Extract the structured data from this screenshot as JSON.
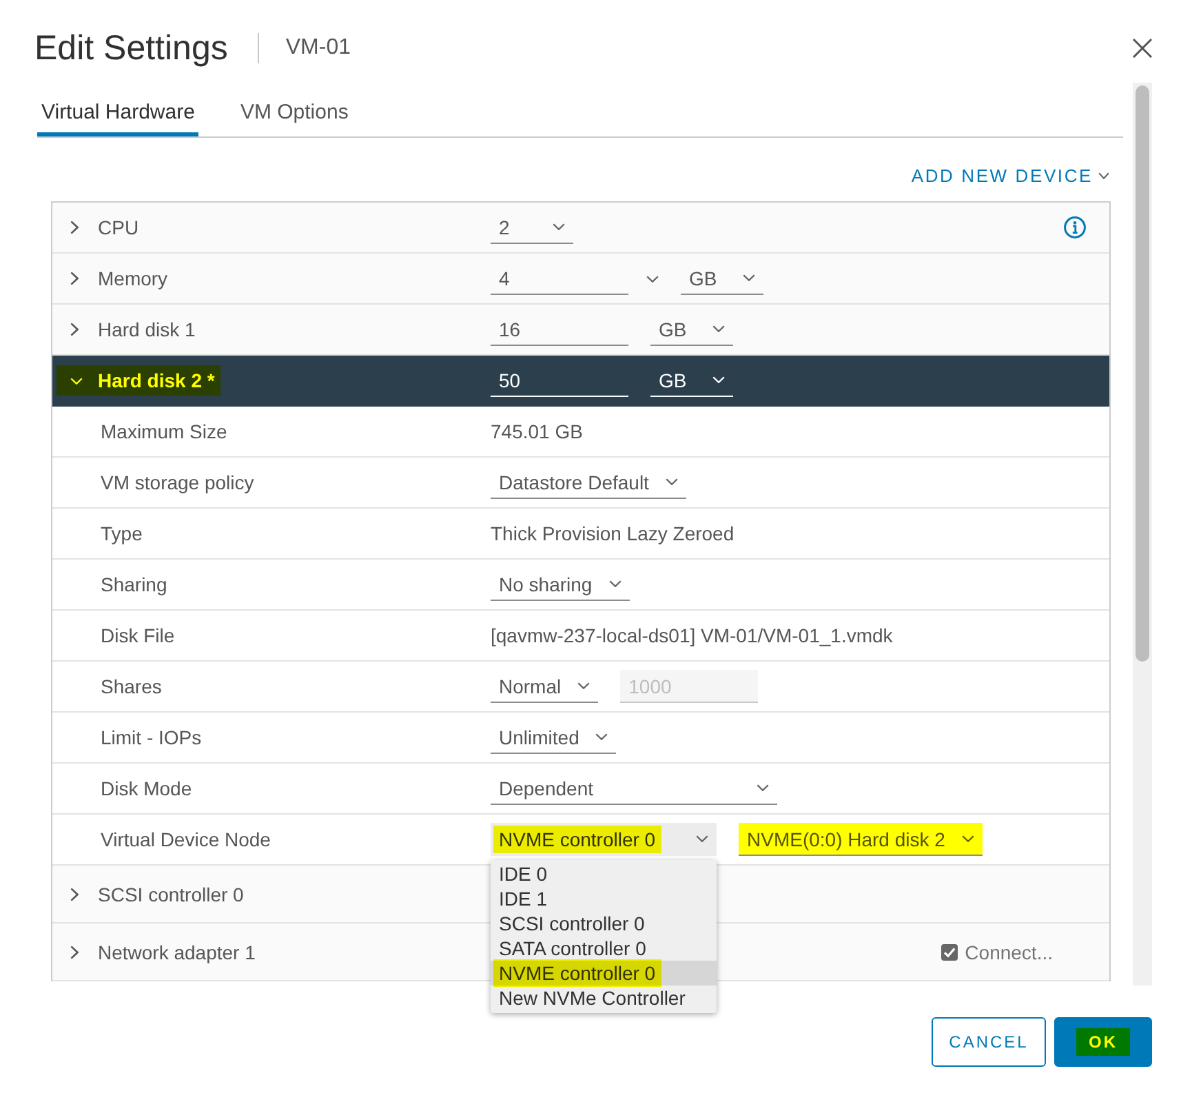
{
  "window": {
    "title": "Edit Settings",
    "subtitle": "VM-01"
  },
  "tabs": [
    {
      "label": "Virtual Hardware",
      "selected": true
    },
    {
      "label": "VM Options",
      "selected": false
    }
  ],
  "add_device": {
    "label": "ADD NEW DEVICE"
  },
  "devices": [
    {
      "label": "CPU",
      "expanded": false,
      "highlighted": false,
      "controls": [
        {
          "kind": "select",
          "value": "2"
        },
        {
          "kind": "info"
        }
      ]
    },
    {
      "label": "Memory",
      "expanded": false,
      "highlighted": false,
      "controls": [
        {
          "kind": "combo",
          "value": "4"
        },
        {
          "kind": "select",
          "value": "GB"
        }
      ]
    },
    {
      "label": "Hard disk 1",
      "expanded": false,
      "highlighted": false,
      "controls": [
        {
          "kind": "input",
          "value": "16",
          "disabled": false
        },
        {
          "kind": "select",
          "value": "GB"
        }
      ]
    },
    {
      "label": "Hard disk 2 *",
      "expanded": true,
      "highlighted": true,
      "controls": [
        {
          "kind": "input",
          "value": "50",
          "disabled": false
        },
        {
          "kind": "select",
          "value": "GB"
        }
      ],
      "children": [
        {
          "label": "Maximum Size",
          "controls": [
            {
              "kind": "text",
              "value": "745.01 GB"
            }
          ]
        },
        {
          "label": "VM storage policy",
          "controls": [
            {
              "kind": "select",
              "value": "Datastore Default"
            }
          ]
        },
        {
          "label": "Type",
          "controls": [
            {
              "kind": "text",
              "value": "Thick Provision Lazy Zeroed"
            }
          ]
        },
        {
          "label": "Sharing",
          "controls": [
            {
              "kind": "select",
              "value": "No sharing"
            }
          ]
        },
        {
          "label": "Disk File",
          "controls": [
            {
              "kind": "text",
              "value": "[qavmw-237-local-ds01] VM-01/VM-01_1.vmdk"
            }
          ]
        },
        {
          "label": "Shares",
          "controls": [
            {
              "kind": "select",
              "value": "Normal"
            },
            {
              "kind": "input",
              "value": "1000",
              "disabled": true
            }
          ]
        },
        {
          "label": "Limit - IOPs",
          "controls": [
            {
              "kind": "select",
              "value": "Unlimited"
            }
          ]
        },
        {
          "label": "Disk Mode",
          "controls": [
            {
              "kind": "wide-select",
              "value": "Dependent"
            }
          ]
        },
        {
          "label": "Virtual Device Node",
          "controls": [
            {
              "kind": "open-select",
              "value": "NVME controller 0",
              "highlighted": true,
              "options": [
                {
                  "label": "IDE 0",
                  "selected": false,
                  "highlighted": false
                },
                {
                  "label": "IDE 1",
                  "selected": false,
                  "highlighted": false
                },
                {
                  "label": "SCSI controller 0",
                  "selected": false,
                  "highlighted": false
                },
                {
                  "label": "SATA controller 0",
                  "selected": false,
                  "highlighted": false
                },
                {
                  "label": "NVME controller 0",
                  "selected": true,
                  "highlighted": true
                },
                {
                  "label": "New NVMe Controller",
                  "selected": false,
                  "highlighted": false
                }
              ]
            },
            {
              "kind": "select",
              "value": "NVME(0:0) Hard disk 2",
              "highlighted": true
            }
          ]
        }
      ]
    },
    {
      "label": "SCSI controller 0",
      "expanded": false,
      "highlighted": false
    },
    {
      "label": "Network adapter 1",
      "expanded": false,
      "highlighted": false,
      "controls": [
        {
          "kind": "checkbox",
          "label": "Connect...",
          "checked": true
        }
      ]
    }
  ],
  "buttons": [
    {
      "kind": "cancel",
      "label": "CANCEL",
      "highlighted": false
    },
    {
      "kind": "confirm",
      "label": "OK",
      "highlighted": true
    }
  ]
}
